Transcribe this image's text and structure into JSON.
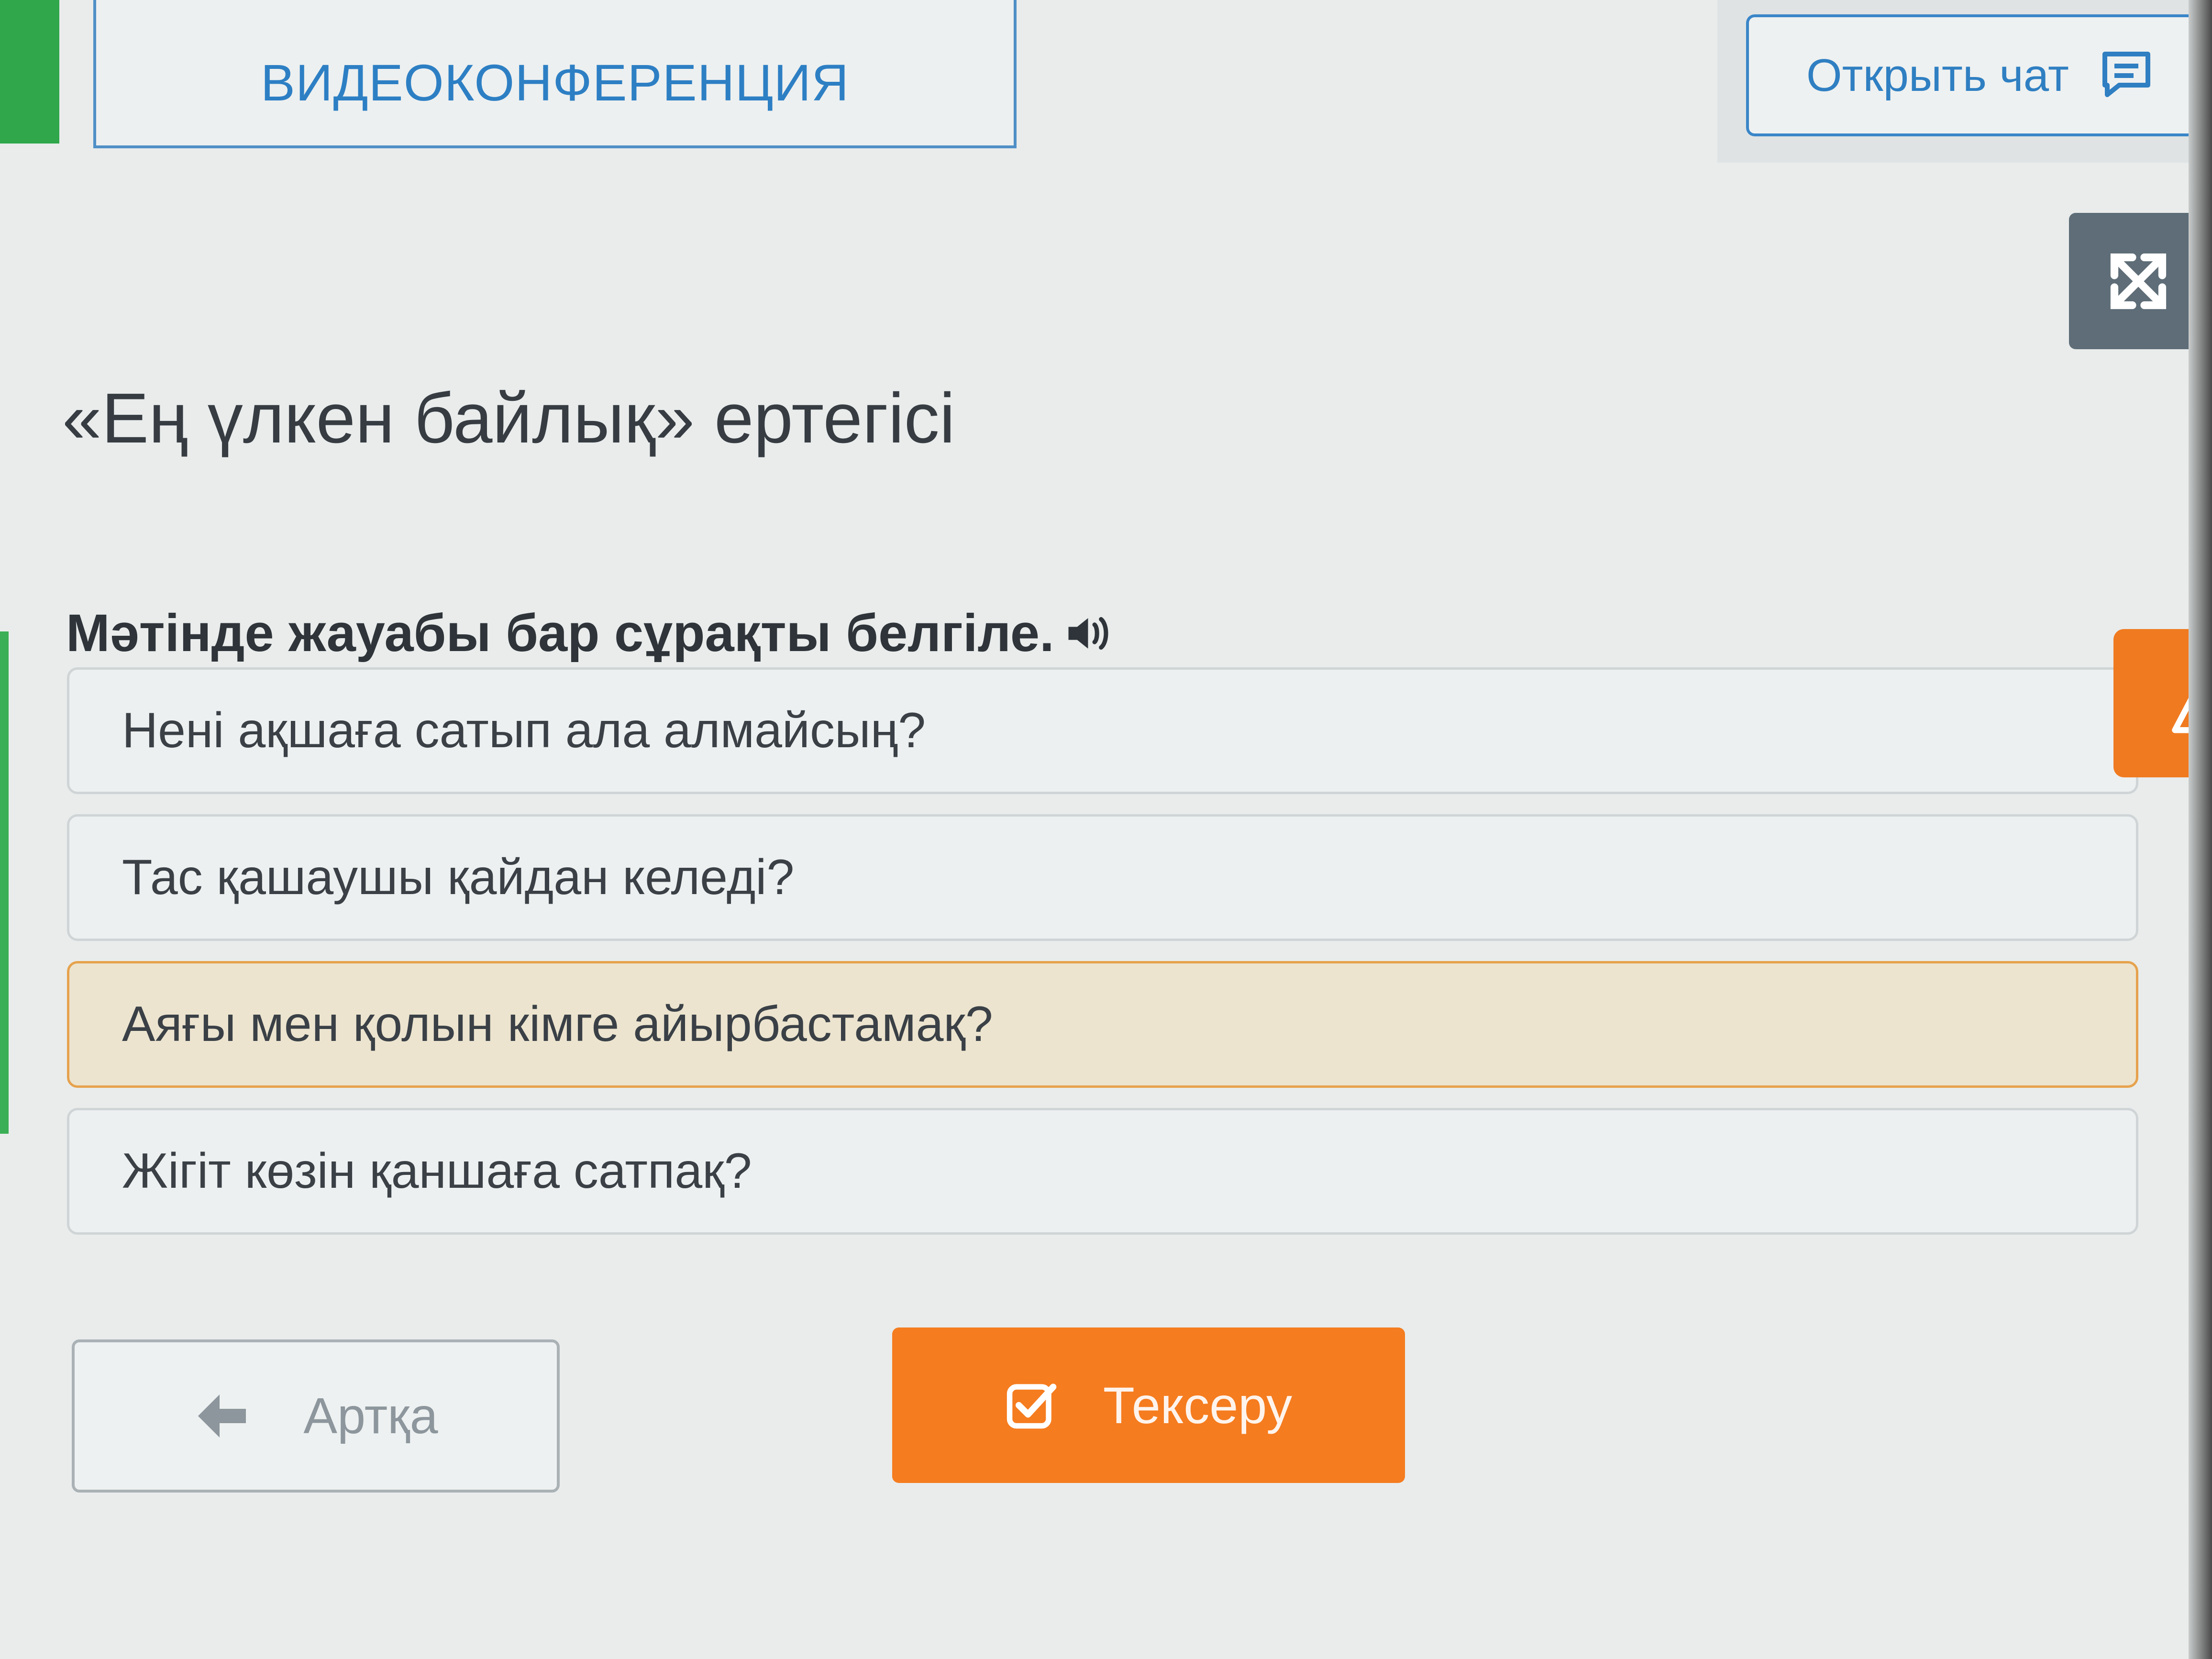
{
  "header": {
    "tab_label": "ВИДЕОКОНФЕРЕНЦИЯ",
    "chat_button_label": "Открыть чат"
  },
  "lesson": {
    "title": "«Ең үлкен байлық» ертегісі"
  },
  "task": {
    "question": "Мәтінде жауабы бар сұрақты белгіле.",
    "answers": [
      {
        "text": "Нені ақшаға сатып ала алмайсың?",
        "selected": false
      },
      {
        "text": "Тас қашаушы қайдан келеді?",
        "selected": false
      },
      {
        "text": "Аяғы мен қолын кімге айырбастамақ?",
        "selected": true
      },
      {
        "text": "Жігіт көзін қаншаға сатпақ?",
        "selected": false
      }
    ]
  },
  "footer": {
    "back_label": "Артқа",
    "check_label": "Тексеру"
  },
  "icons": {
    "chat": "chat-icon",
    "expand": "expand-icon",
    "sound": "speaker-icon",
    "warning": "warning-icon",
    "back": "arrow-left-icon",
    "check": "checkbox-icon"
  },
  "colors": {
    "accent_blue": "#2d7fc4",
    "accent_orange": "#f57c1f",
    "selected_border": "#e6a24d",
    "selected_bg": "#ece4cf"
  }
}
